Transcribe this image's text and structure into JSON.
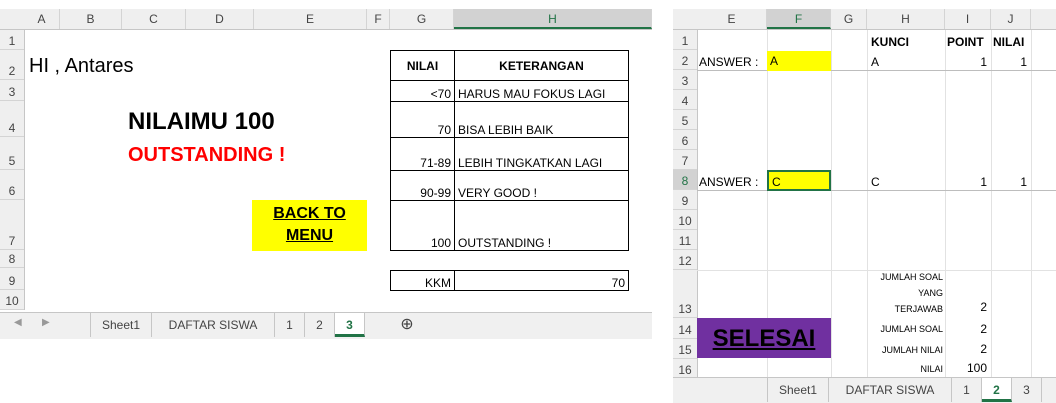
{
  "left": {
    "columns": [
      "A",
      "B",
      "C",
      "D",
      "E",
      "F",
      "G",
      "H"
    ],
    "rows": [
      "1",
      "2",
      "3",
      "4",
      "5",
      "6",
      "7",
      "8",
      "9",
      "10"
    ],
    "greeting": "HI ,  Antares",
    "score_title": "NILAIMU 100",
    "score_status": "OUTSTANDING !",
    "back_button": [
      "BACK TO",
      "MENU"
    ],
    "table_header": {
      "nilai": "NILAI",
      "keterangan": "KETERANGAN"
    },
    "table_rows": [
      {
        "nilai": "<70",
        "ket": "HARUS MAU FOKUS LAGI"
      },
      {
        "nilai": "70",
        "ket": "BISA LEBIH BAIK"
      },
      {
        "nilai": "71-89",
        "ket": "LEBIH TINGKATKAN LAGI"
      },
      {
        "nilai": "90-99",
        "ket": "VERY GOOD !"
      },
      {
        "nilai": "100",
        "ket": "OUTSTANDING !"
      }
    ],
    "kkm_label": "KKM",
    "kkm_value": "70",
    "tabs": [
      "Sheet1",
      "DAFTAR SISWA",
      "1",
      "2",
      "3"
    ],
    "active_tab": "3",
    "add_sheet": "⊕"
  },
  "right": {
    "columns": [
      "E",
      "F",
      "G",
      "H",
      "I",
      "J"
    ],
    "rows": [
      "1",
      "2",
      "3",
      "4",
      "5",
      "6",
      "7",
      "8",
      "9",
      "10",
      "11",
      "12",
      "13",
      "14",
      "15",
      "16"
    ],
    "headers": {
      "kunci": "KUNCI",
      "point": "POINT",
      "nilai": "NILAI"
    },
    "answer_label": "ANSWER :",
    "q1": {
      "answer": "A",
      "kunci": "A",
      "point": "1",
      "nilai": "1"
    },
    "q2": {
      "answer": "C",
      "kunci": "C",
      "point": "1",
      "nilai": "1"
    },
    "jumlah_terjawab_label": [
      "JUMLAH SOAL",
      "YANG",
      "TERJAWAB"
    ],
    "jumlah_terjawab_value": "2",
    "jumlah_soal_label": "JUMLAH SOAL",
    "jumlah_soal_value": "2",
    "jumlah_nilai_label": "JUMLAH NILAI",
    "jumlah_nilai_value": "2",
    "nilai_label": "NILAI",
    "nilai_value": "100",
    "selesai_button": "SELESAI",
    "tabs": [
      "Sheet1",
      "DAFTAR SISWA",
      "1",
      "2",
      "3"
    ],
    "active_tab": "2"
  },
  "colors": {
    "yellow": "#ffff00",
    "purple": "#7030a0",
    "red": "#ff0000",
    "excel_green": "#217346"
  }
}
